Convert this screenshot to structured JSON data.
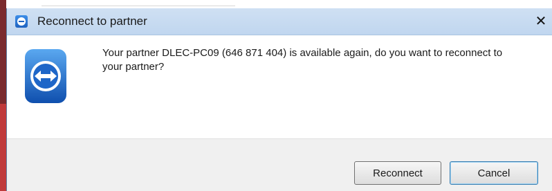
{
  "dialog": {
    "title": "Reconnect to partner",
    "close_label": "✕",
    "message": "Your partner DLEC-PC09 (646 871 404) is available again, do you want to reconnect to your partner?",
    "buttons": {
      "reconnect_label": "Reconnect",
      "cancel_label": "Cancel"
    },
    "icons": {
      "title_icon": "teamviewer-icon",
      "main_icon": "teamviewer-logo-icon"
    },
    "colors": {
      "titlebar": "#c0d6ef",
      "icon_blue": "#1f63c0"
    }
  }
}
